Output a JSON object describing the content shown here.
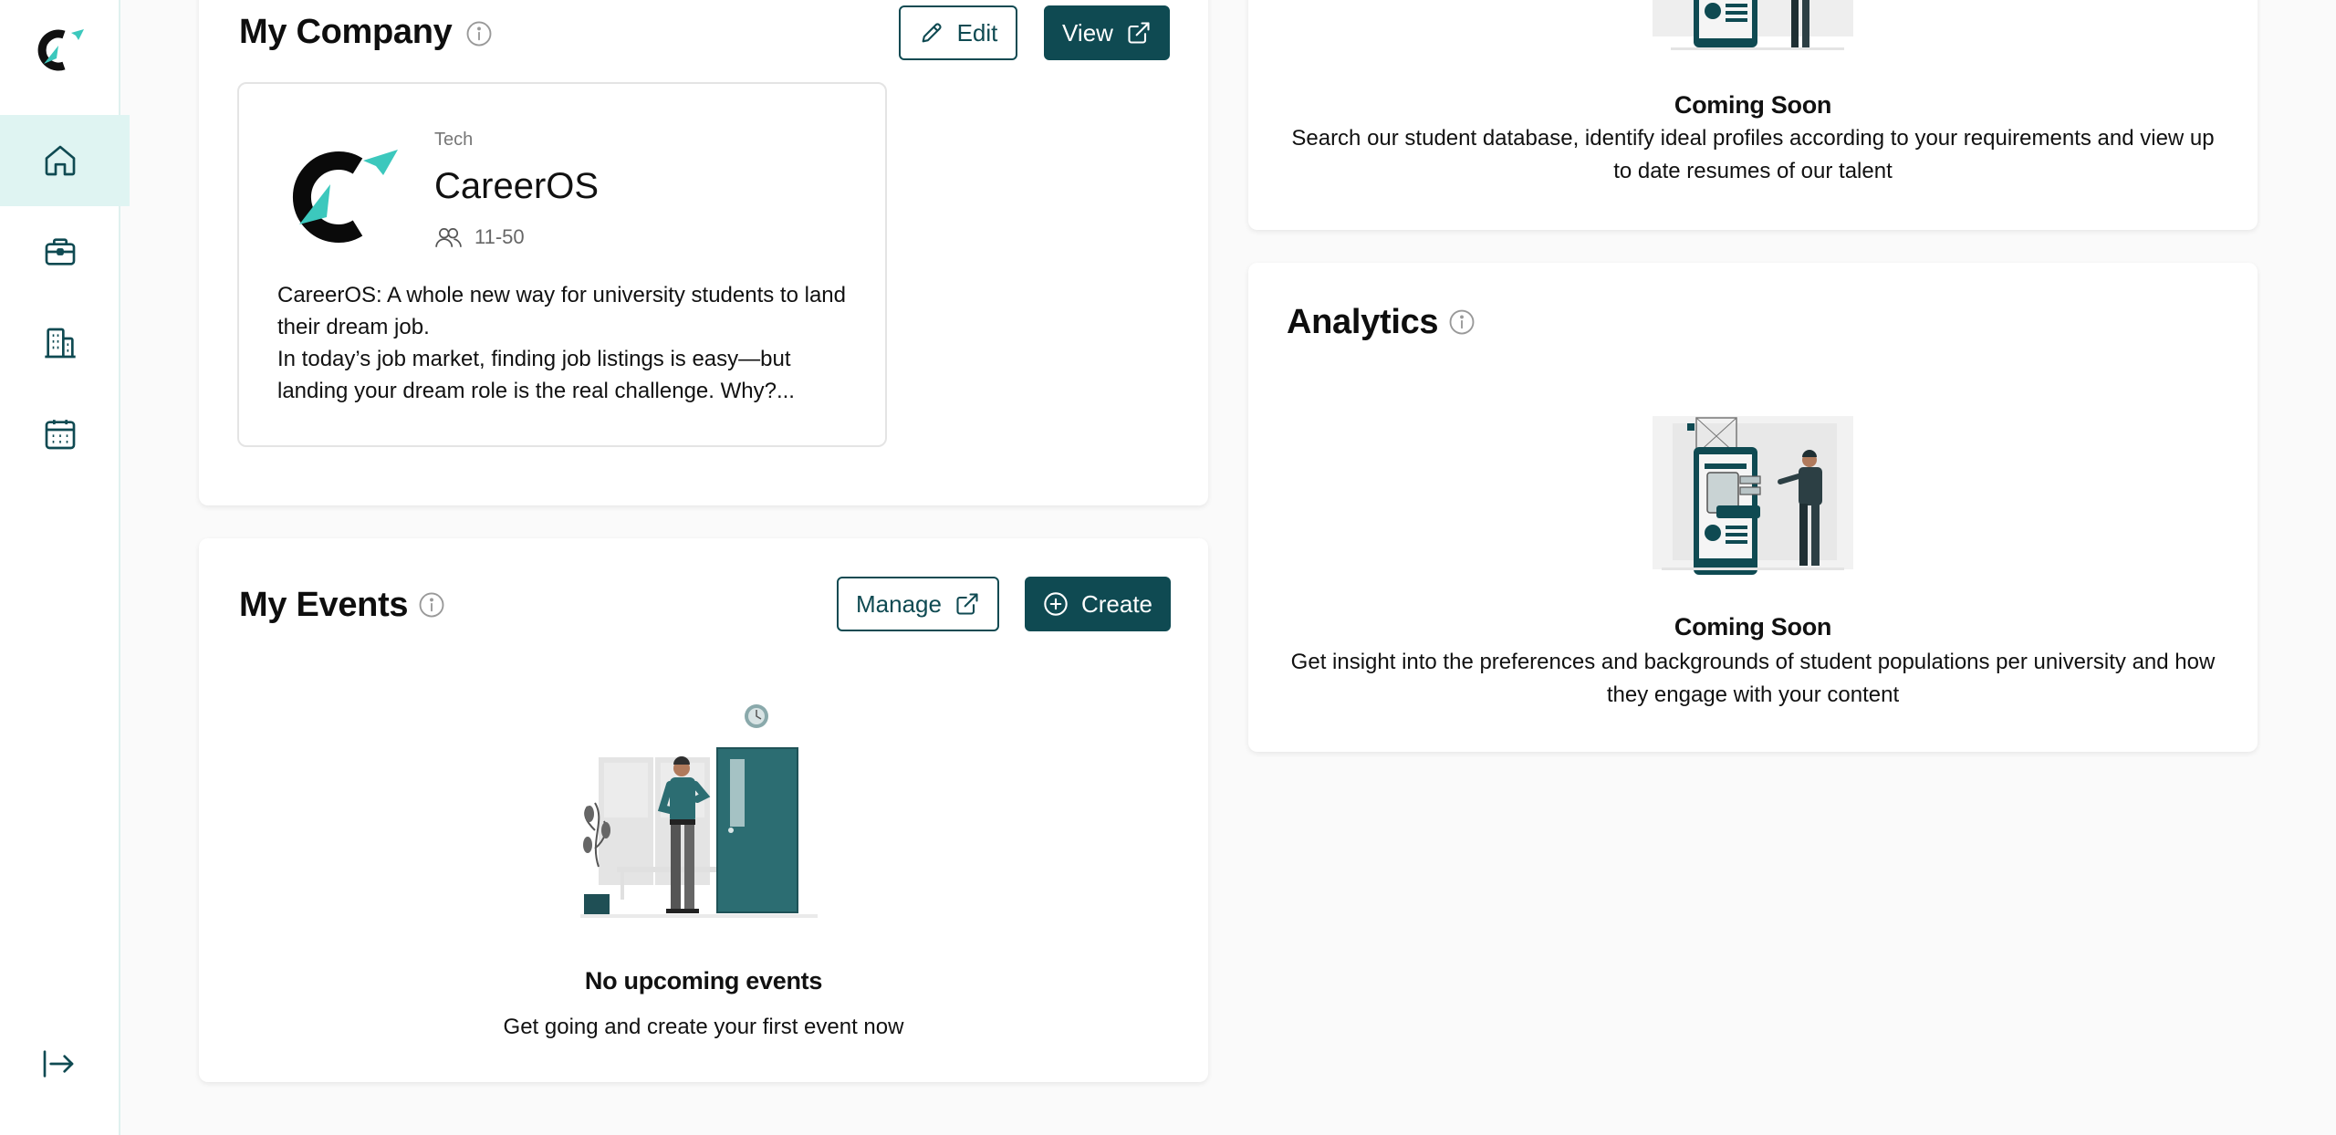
{
  "sidebar": {
    "logo": "careeros-logo",
    "items": [
      {
        "name": "home",
        "icon": "home-icon",
        "active": true
      },
      {
        "name": "jobs",
        "icon": "briefcase-icon",
        "active": false
      },
      {
        "name": "company",
        "icon": "building-icon",
        "active": false
      },
      {
        "name": "events",
        "icon": "calendar-icon",
        "active": false
      }
    ],
    "collapse_icon": "arrow-right-to-bar-icon"
  },
  "my_company": {
    "title": "My Company",
    "edit_label": "Edit",
    "view_label": "View",
    "company": {
      "category": "Tech",
      "name": "CareerOS",
      "size": "11-50",
      "description_line1": "CareerOS: A whole new way for university students to land their dream job.",
      "description_line2": "In today’s job market, finding job listings is easy—but landing your dream role is the real challenge. Why?..."
    }
  },
  "my_events": {
    "title": "My Events",
    "manage_label": "Manage",
    "create_label": "Create",
    "empty_title": "No upcoming events",
    "empty_text": "Get going and create your first event now"
  },
  "talent_search": {
    "coming_soon": "Coming Soon",
    "text": "Search our student database, identify ideal profiles according to your requirements and view up to date resumes of our talent"
  },
  "analytics": {
    "title": "Analytics",
    "coming_soon": "Coming Soon",
    "text": "Get insight into the preferences and backgrounds of student populations per university and how they engage with your content"
  },
  "colors": {
    "primary": "#0f4a52",
    "accent": "#3cc8bd",
    "sidebar_active": "#dff4f2"
  }
}
